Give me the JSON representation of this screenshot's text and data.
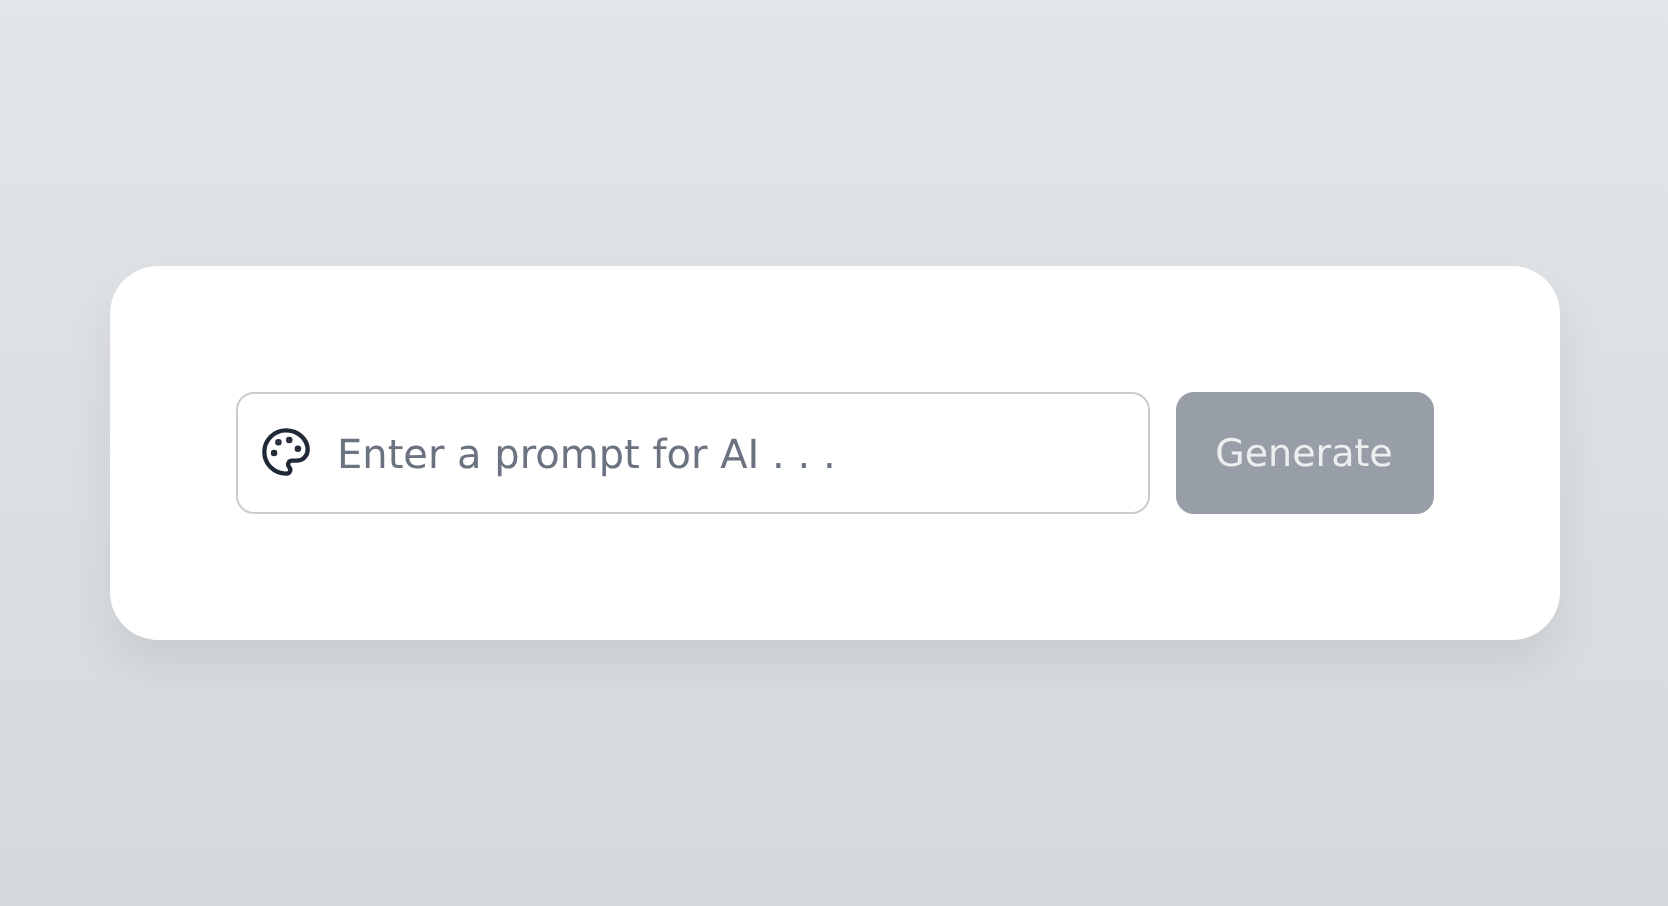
{
  "prompt": {
    "placeholder": "Enter a prompt for AI . . ."
  },
  "generate_button": {
    "label": "Generate",
    "disabled": true
  }
}
